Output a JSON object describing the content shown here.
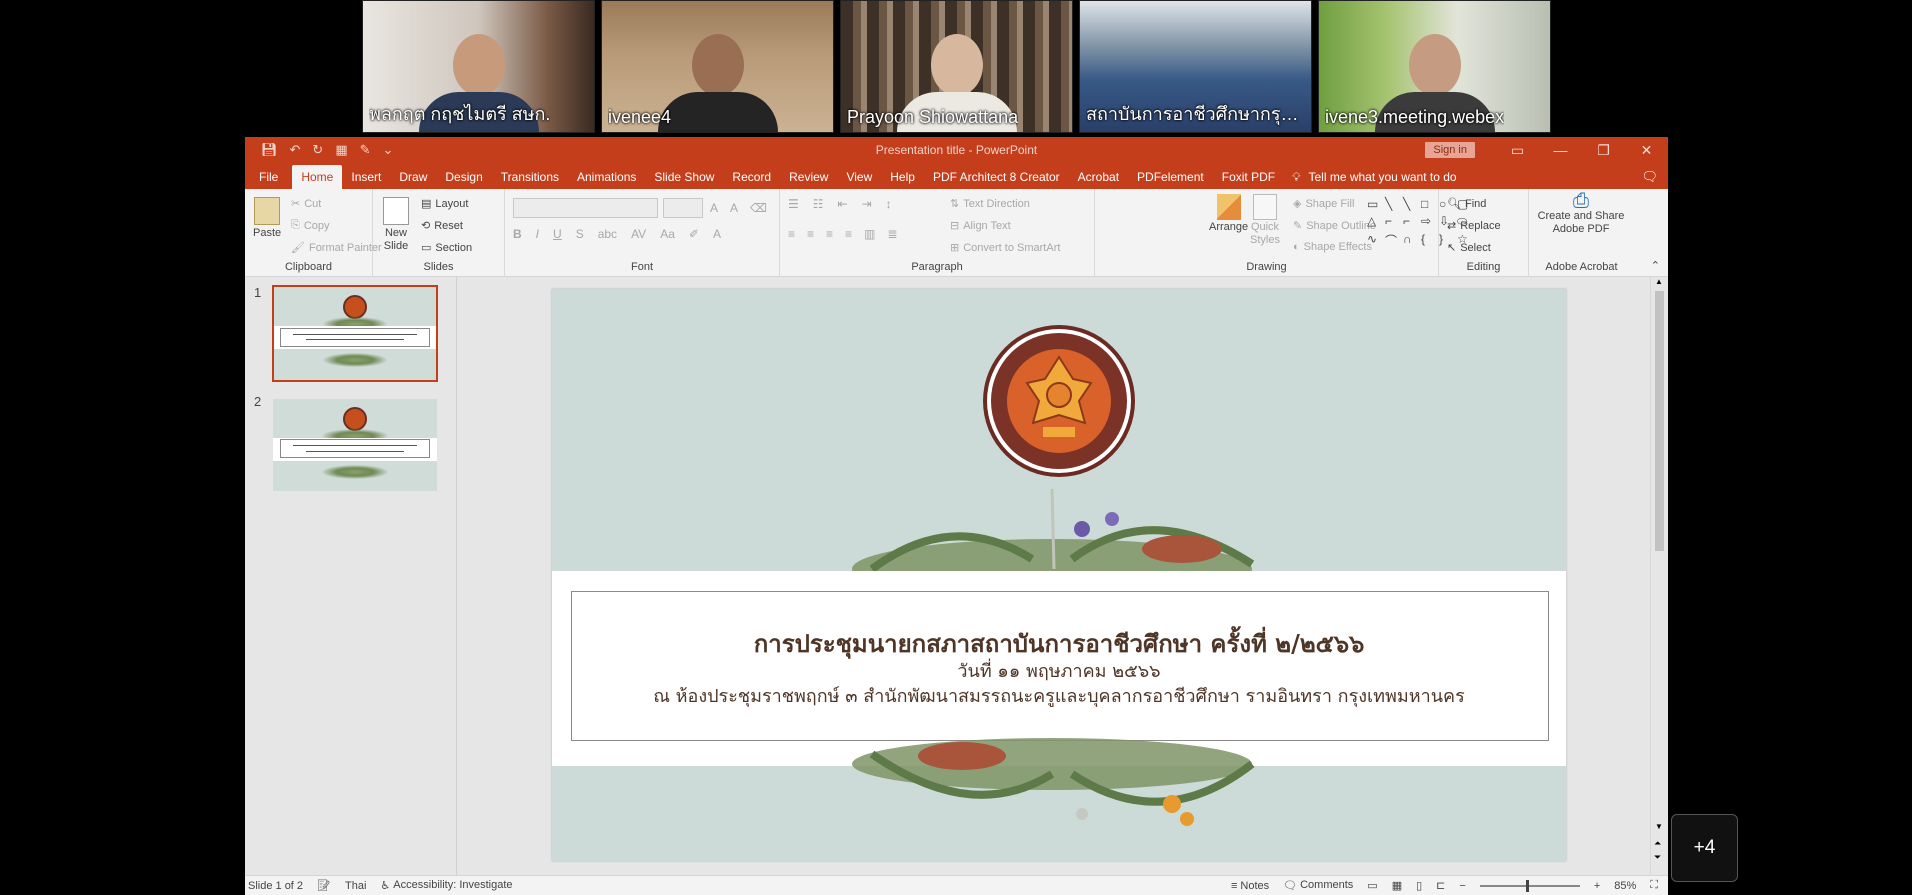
{
  "participants": [
    {
      "name": "พลกฤต กฤชไมตรี สษก."
    },
    {
      "name": "ivenee4"
    },
    {
      "name": "Prayoon Shiowattana"
    },
    {
      "name": "สถาบันการอาชีวศึกษากรุงเ..."
    },
    {
      "name": "ivene3.meeting.webex"
    }
  ],
  "more_participants": "+4",
  "window": {
    "title": "Presentation title  -  PowerPoint",
    "sign_in": "Sign in",
    "minimize": "—",
    "restore": "❐",
    "close": "✕"
  },
  "tabs": [
    "File",
    "Home",
    "Insert",
    "Draw",
    "Design",
    "Transitions",
    "Animations",
    "Slide Show",
    "Record",
    "Review",
    "View",
    "Help",
    "PDF Architect 8 Creator",
    "Acrobat",
    "PDFelement",
    "Foxit PDF"
  ],
  "tell_me": "Tell me what you want to do",
  "ribbon": {
    "clipboard": {
      "paste": "Paste",
      "cut": "Cut",
      "copy": "Copy",
      "format_painter": "Format Painter",
      "label": "Clipboard"
    },
    "slides": {
      "new_slide": "New Slide",
      "layout": "Layout",
      "reset": "Reset",
      "section": "Section",
      "label": "Slides"
    },
    "font": {
      "label": "Font"
    },
    "paragraph": {
      "text_direction": "Text Direction",
      "align_text": "Align Text",
      "convert_smartart": "Convert to SmartArt",
      "label": "Paragraph"
    },
    "drawing": {
      "arrange": "Arrange",
      "quick_styles": "Quick Styles",
      "shape_fill": "Shape Fill",
      "shape_outline": "Shape Outline",
      "shape_effects": "Shape Effects",
      "label": "Drawing"
    },
    "editing": {
      "find": "Find",
      "replace": "Replace",
      "select": "Select",
      "label": "Editing"
    },
    "acrobat": {
      "create_share": "Create and Share Adobe PDF",
      "label": "Adobe Acrobat"
    }
  },
  "slides": [
    {
      "number": "1"
    },
    {
      "number": "2"
    }
  ],
  "slide": {
    "title": "การประชุมนายกสภาสถาบันการอาชีวศึกษา ครั้งที่ ๒/๒๕๖๖",
    "date": "วันที่ ๑๑ พฤษภาคม ๒๕๖๖",
    "venue": "ณ ห้องประชุมราชพฤกษ์ ๓ สำนักพัฒนาสมรรถนะครูและบุคลากรอาชีวศึกษา รามอินทรา กรุงเทพมหานคร"
  },
  "status": {
    "slide_of": "Slide 1 of 2",
    "language": "Thai",
    "accessibility": "Accessibility: Investigate",
    "notes": "Notes",
    "comments": "Comments",
    "zoom": "85%"
  },
  "colors": {
    "accent": "#c43e1c",
    "slide_bg": "#cddbd8",
    "title_text": "#4e3526"
  }
}
